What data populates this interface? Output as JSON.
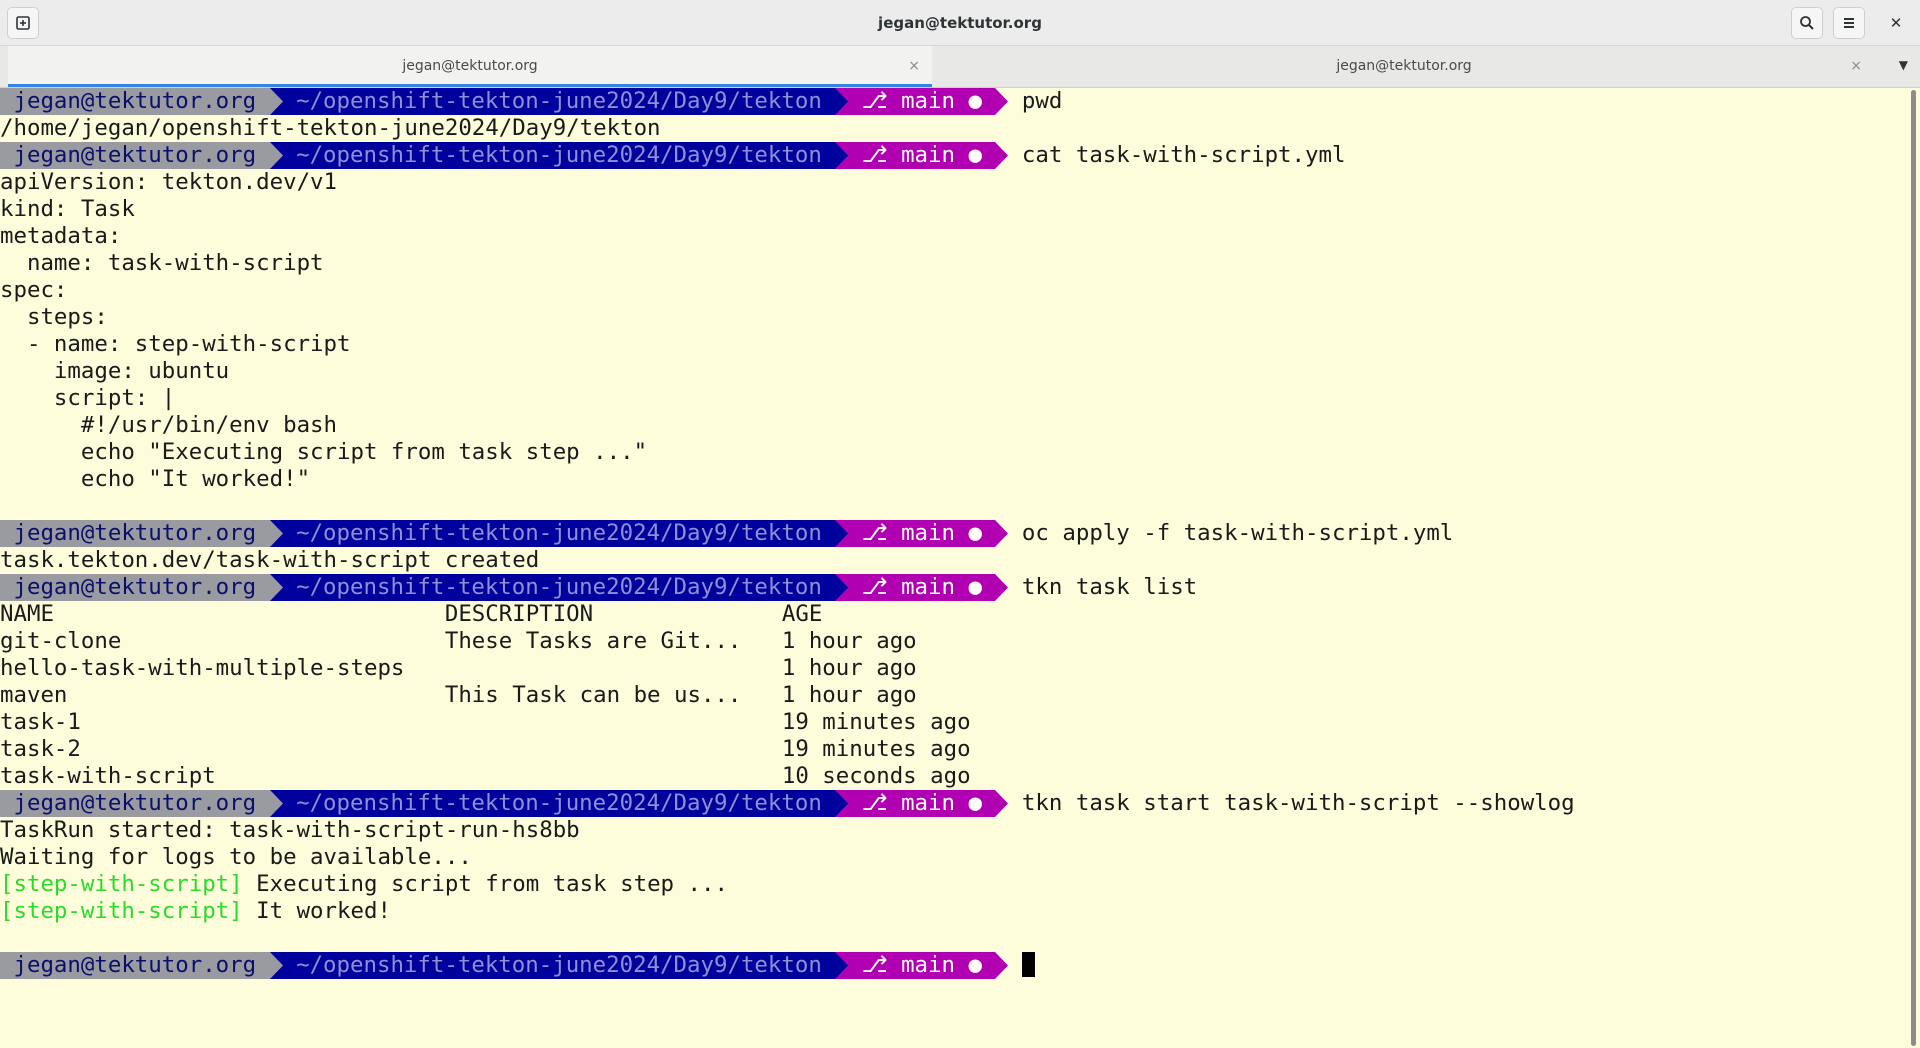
{
  "window": {
    "title": "jegan@tektutor.org",
    "new_tab_icon": "new-tab-icon",
    "search_icon": "search-icon",
    "menu_icon": "hamburger-menu-icon",
    "close_icon": "close-icon",
    "close_glyph": "✕"
  },
  "tabs": [
    {
      "label": "jegan@tektutor.org",
      "active": true,
      "close": "×"
    },
    {
      "label": "jegan@tektutor.org",
      "active": false,
      "close": "×"
    }
  ],
  "tab_menu_glyph": "▼",
  "prompt": {
    "user": " jegan@tektutor.org ",
    "path": " ~/openshift-tekton-june2024/Day9/tekton ",
    "git": " ⎇ main ● ",
    "colors": {
      "user_bg": "#9a9ba1",
      "path_bg": "#00009c",
      "git_bg": "#b100b1",
      "terminal_bg": "#fdfddb"
    }
  },
  "lines": [
    {
      "type": "prompt",
      "cmd": "pwd"
    },
    {
      "type": "text",
      "text": "/home/jegan/openshift-tekton-june2024/Day9/tekton"
    },
    {
      "type": "prompt",
      "cmd": "cat task-with-script.yml"
    },
    {
      "type": "text",
      "text": "apiVersion: tekton.dev/v1"
    },
    {
      "type": "text",
      "text": "kind: Task"
    },
    {
      "type": "text",
      "text": "metadata:"
    },
    {
      "type": "text",
      "text": "  name: task-with-script"
    },
    {
      "type": "text",
      "text": "spec:"
    },
    {
      "type": "text",
      "text": "  steps:"
    },
    {
      "type": "text",
      "text": "  - name: step-with-script"
    },
    {
      "type": "text",
      "text": "    image: ubuntu"
    },
    {
      "type": "text",
      "text": "    script: |"
    },
    {
      "type": "text",
      "text": "      #!/usr/bin/env bash"
    },
    {
      "type": "text",
      "text": "      echo \"Executing script from task step ...\""
    },
    {
      "type": "text",
      "text": "      echo \"It worked!\""
    },
    {
      "type": "text",
      "text": ""
    },
    {
      "type": "prompt",
      "cmd": "oc apply -f task-with-script.yml"
    },
    {
      "type": "text",
      "text": "task.tekton.dev/task-with-script created"
    },
    {
      "type": "prompt",
      "cmd": "tkn task list"
    },
    {
      "type": "text",
      "text": "NAME                             DESCRIPTION              AGE"
    },
    {
      "type": "text",
      "text": "git-clone                        These Tasks are Git...   1 hour ago"
    },
    {
      "type": "text",
      "text": "hello-task-with-multiple-steps                            1 hour ago"
    },
    {
      "type": "text",
      "text": "maven                            This Task can be us...   1 hour ago"
    },
    {
      "type": "text",
      "text": "task-1                                                    19 minutes ago"
    },
    {
      "type": "text",
      "text": "task-2                                                    19 minutes ago"
    },
    {
      "type": "text",
      "text": "task-with-script                                          10 seconds ago"
    },
    {
      "type": "prompt",
      "cmd": "tkn task start task-with-script --showlog"
    },
    {
      "type": "text",
      "text": "TaskRun started: task-with-script-run-hs8bb"
    },
    {
      "type": "text",
      "text": "Waiting for logs to be available..."
    },
    {
      "type": "log",
      "tag": "[step-with-script]",
      "text": " Executing script from task step ..."
    },
    {
      "type": "log",
      "tag": "[step-with-script]",
      "text": " It worked!"
    },
    {
      "type": "text",
      "text": ""
    },
    {
      "type": "prompt",
      "cmd": "",
      "cursor": true
    }
  ]
}
